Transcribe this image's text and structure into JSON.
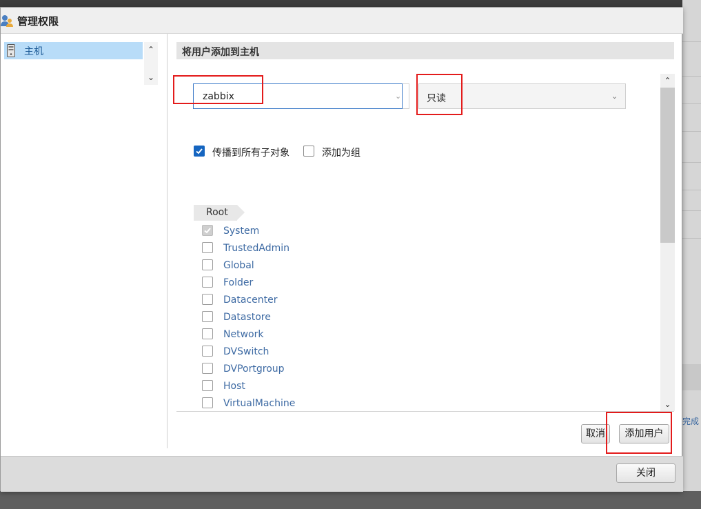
{
  "dialog": {
    "title": "管理权限"
  },
  "nav": {
    "items": [
      {
        "label": "主机",
        "selected": true
      }
    ]
  },
  "main": {
    "section_title": "将用户添加到主机",
    "user_select": {
      "value": "zabbix"
    },
    "role_select": {
      "value": "只读"
    },
    "options": {
      "propagate": {
        "label": "传播到所有子对象",
        "checked": true
      },
      "add_as_group": {
        "label": "添加为组",
        "checked": false
      }
    },
    "breadcrumb": "Root",
    "privileges": [
      {
        "label": "System",
        "checked": true,
        "disabled": true
      },
      {
        "label": "TrustedAdmin",
        "checked": false
      },
      {
        "label": "Global",
        "checked": false
      },
      {
        "label": "Folder",
        "checked": false
      },
      {
        "label": "Datacenter",
        "checked": false
      },
      {
        "label": "Datastore",
        "checked": false
      },
      {
        "label": "Network",
        "checked": false
      },
      {
        "label": "DVSwitch",
        "checked": false
      },
      {
        "label": "DVPortgroup",
        "checked": false
      },
      {
        "label": "Host",
        "checked": false
      },
      {
        "label": "VirtualMachine",
        "checked": false
      }
    ],
    "cancel_label": "取消",
    "add_user_label": "添加用户"
  },
  "footer": {
    "close_label": "关闭"
  },
  "background": {
    "partial_text": "完成"
  },
  "colors": {
    "accent": "#1565c0",
    "selection": "#b8dcf8",
    "annotation": "#e31b1b"
  }
}
